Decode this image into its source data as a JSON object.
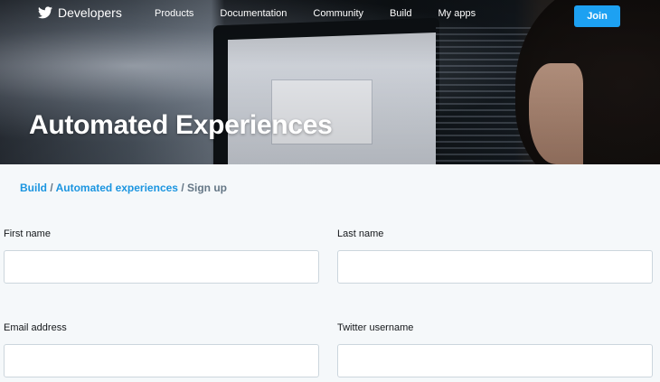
{
  "nav": {
    "brand": "Developers",
    "links": [
      "Products",
      "Documentation",
      "Community",
      "Build",
      "My apps"
    ],
    "join_label": "Join"
  },
  "hero": {
    "title": "Automated Experiences"
  },
  "breadcrumb": {
    "items": [
      "Build",
      "Automated experiences",
      "Sign up"
    ],
    "separator": "/"
  },
  "form": {
    "first_name": {
      "label": "First name",
      "value": "",
      "placeholder": ""
    },
    "last_name": {
      "label": "Last name",
      "value": "",
      "placeholder": ""
    },
    "email": {
      "label": "Email address",
      "value": "",
      "placeholder": ""
    },
    "twitter_username": {
      "label": "Twitter username",
      "value": "",
      "placeholder": ""
    }
  },
  "colors": {
    "accent": "#1da1f2",
    "link": "#1b95e0",
    "page_bg": "#f5f8fa"
  },
  "icons": {
    "brand": "twitter-bird-icon"
  }
}
